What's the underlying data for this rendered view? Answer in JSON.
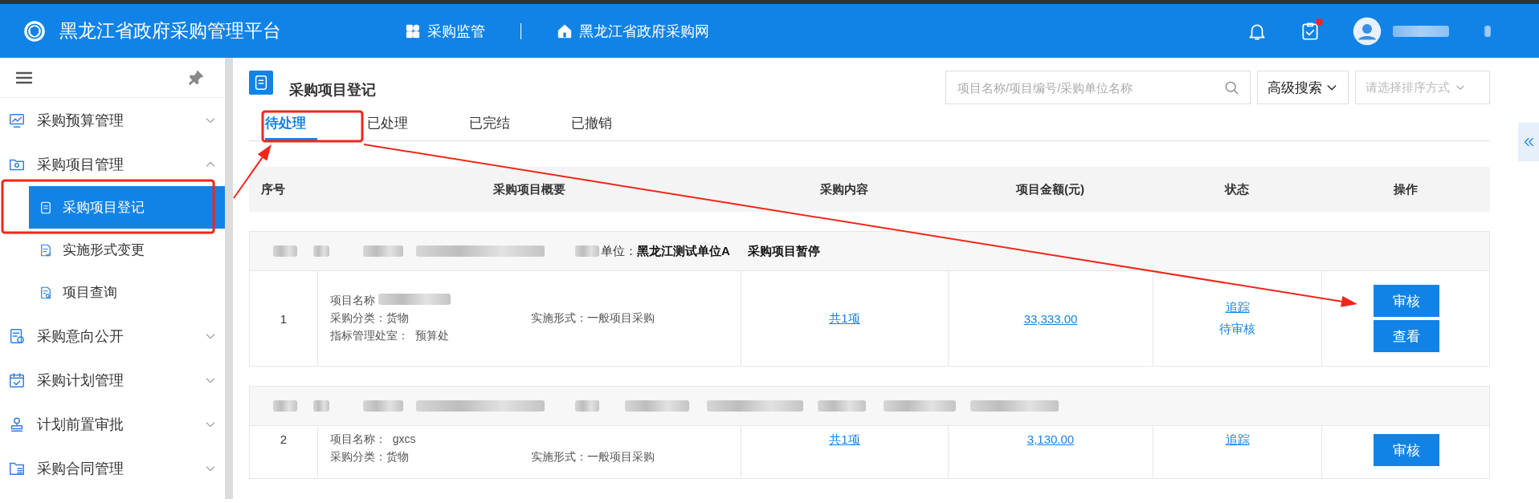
{
  "header": {
    "title": "黑龙江省政府采购管理平台",
    "nav": [
      {
        "label": "采购监管"
      },
      {
        "label": "黑龙江省政府采购网"
      }
    ],
    "task_badge": true,
    "user_redacted": true
  },
  "sidebar": {
    "items": [
      {
        "label": "采购预算管理",
        "expanded": false
      },
      {
        "label": "采购项目管理",
        "expanded": true,
        "children": [
          {
            "label": "采购项目登记",
            "selected": true
          },
          {
            "label": "实施形式变更",
            "selected": false
          },
          {
            "label": "项目查询",
            "selected": false
          }
        ]
      },
      {
        "label": "采购意向公开",
        "expanded": false
      },
      {
        "label": "采购计划管理",
        "expanded": false
      },
      {
        "label": "计划前置审批",
        "expanded": false
      },
      {
        "label": "采购合同管理",
        "expanded": false
      }
    ]
  },
  "page": {
    "title": "采购项目登记",
    "search": {
      "placeholder": "项目名称/项目编号/采购单位名称"
    },
    "advanced_search": "高级搜索",
    "sort": {
      "placeholder": "请选择排序方式"
    }
  },
  "tabs": [
    {
      "label": "待处理",
      "selected": true
    },
    {
      "label": "已处理",
      "selected": false
    },
    {
      "label": "已完结",
      "selected": false
    },
    {
      "label": "已撤销",
      "selected": false
    }
  ],
  "table": {
    "columns": [
      "序号",
      "采购项目概要",
      "采购内容",
      "项目金额(元)",
      "状态",
      "操作"
    ],
    "groups": [
      {
        "header": {
          "redacted": true,
          "unit_label": "单位：",
          "unit": "黑龙江测试单位A",
          "status": "采购项目暂停"
        },
        "row": {
          "index": "1",
          "name_label": "项目名称",
          "name_redacted": true,
          "category": "采购分类：货物",
          "form": "实施形式：一般项目采购",
          "dept_label": "指标管理处室：",
          "dept": "预算处",
          "content": "共1项",
          "amount": "33,333.00",
          "track": "追踪",
          "status": "待审核",
          "actions": [
            "审核",
            "查看"
          ]
        }
      },
      {
        "header": {
          "redacted": true
        },
        "row": {
          "index": "2",
          "name_label": "项目名称：",
          "name": "gxcs",
          "category": "采购分类：货物",
          "form": "实施形式：一般项目采购",
          "content": "共1项",
          "amount": "3,130.00",
          "track": "追踪",
          "actions": [
            "审核"
          ]
        }
      }
    ]
  },
  "annotations": [
    {
      "kind": "box"
    },
    {
      "kind": "box"
    },
    {
      "kind": "arrow"
    },
    {
      "kind": "arrow"
    }
  ]
}
